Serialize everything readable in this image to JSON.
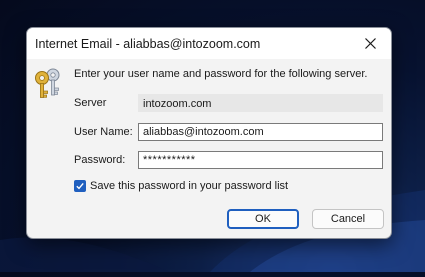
{
  "dialog": {
    "title": "Internet Email - aliabbas@intozoom.com",
    "prompt": "Enter your user name and password for the following server.",
    "server_label": "Server",
    "server_value": "intozoom.com",
    "username_label": "User Name:",
    "username_value": "aliabbas@intozoom.com",
    "password_label": "Password:",
    "password_value": "***********",
    "save_password_label": "Save this password in your password list",
    "save_password_checked": true,
    "ok_label": "OK",
    "cancel_label": "Cancel"
  },
  "icons": {
    "close": "close-icon",
    "keys": "keys-icon",
    "checkmark": "checkmark-icon"
  },
  "colors": {
    "accent": "#1f5fbf",
    "dialog_bg": "#f3f3f3",
    "key_gold": "#e0b23a"
  }
}
